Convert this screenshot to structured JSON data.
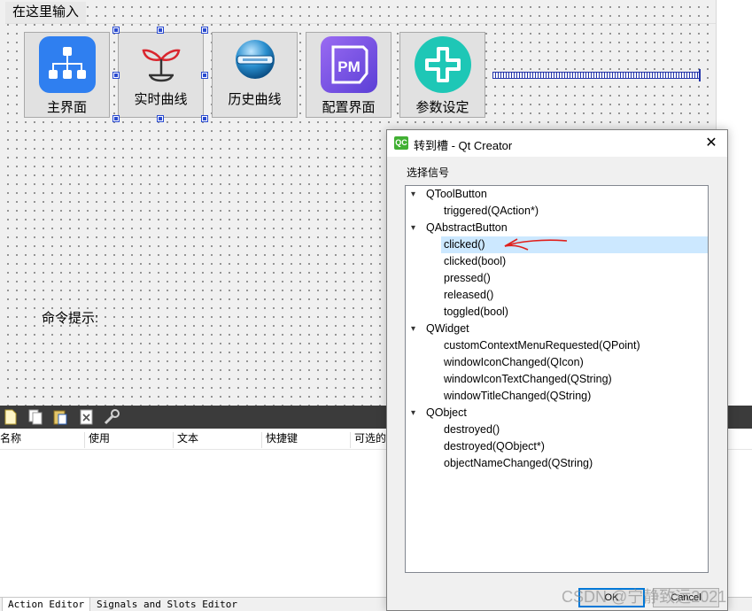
{
  "form": {
    "menu_input": "在这里输入",
    "command_label": "命令提示:",
    "tool_buttons": [
      {
        "label": "主界面",
        "icon": "org-chart-icon"
      },
      {
        "label": "实时曲线",
        "icon": "sprout-icon"
      },
      {
        "label": "历史曲线",
        "icon": "hdd-icon"
      },
      {
        "label": "配置界面",
        "icon": "pm-icon"
      },
      {
        "label": "参数设定",
        "icon": "cross-badge-icon"
      }
    ]
  },
  "action_editor": {
    "columns": [
      "名称",
      "使用",
      "文本",
      "快捷键",
      "可选的"
    ],
    "tabs": [
      "Action Editor",
      "Signals and Slots Editor"
    ]
  },
  "dialog": {
    "title": "转到槽 - Qt Creator",
    "app_icon_text": "QC",
    "group_label": "选择信号",
    "tree": [
      {
        "label": "QToolButton",
        "level": 0
      },
      {
        "label": "triggered(QAction*)",
        "level": 1
      },
      {
        "label": "QAbstractButton",
        "level": 0
      },
      {
        "label": "clicked()",
        "level": 1,
        "selected": true
      },
      {
        "label": "clicked(bool)",
        "level": 1
      },
      {
        "label": "pressed()",
        "level": 1
      },
      {
        "label": "released()",
        "level": 1
      },
      {
        "label": "toggled(bool)",
        "level": 1
      },
      {
        "label": "QWidget",
        "level": 0
      },
      {
        "label": "customContextMenuRequested(QPoint)",
        "level": 1
      },
      {
        "label": "windowIconChanged(QIcon)",
        "level": 1
      },
      {
        "label": "windowIconTextChanged(QString)",
        "level": 1
      },
      {
        "label": "windowTitleChanged(QString)",
        "level": 1
      },
      {
        "label": "QObject",
        "level": 0
      },
      {
        "label": "destroyed()",
        "level": 1
      },
      {
        "label": "destroyed(QObject*)",
        "level": 1
      },
      {
        "label": "objectNameChanged(QString)",
        "level": 1
      }
    ],
    "ok_label": "OK",
    "cancel_label": "Cancel"
  },
  "watermark": "CSDN @宁静致远2021",
  "colors": {
    "selection": "#cce8ff",
    "annotation_arrow": "#e0201c",
    "qt_green": "#41b033"
  }
}
